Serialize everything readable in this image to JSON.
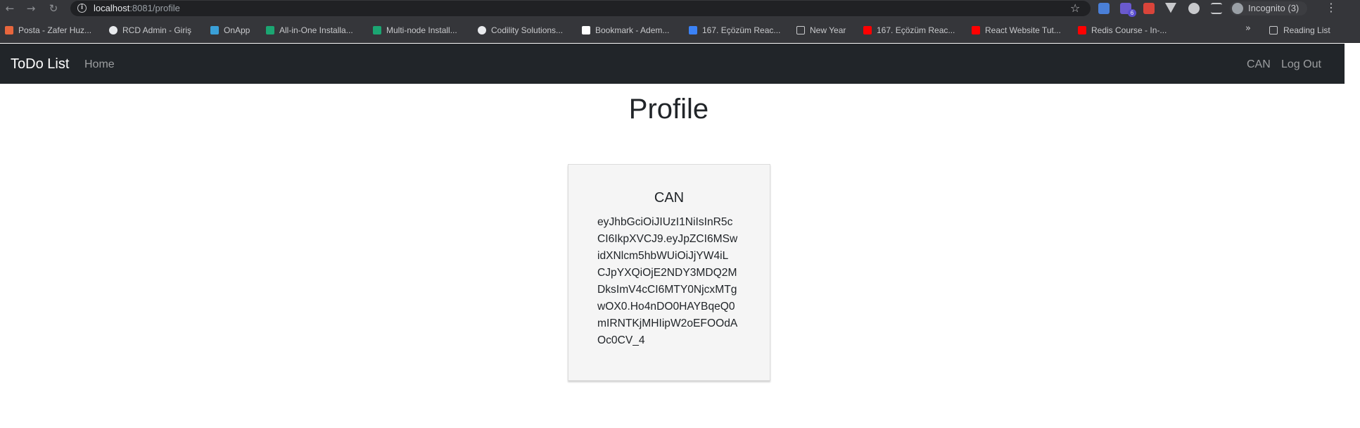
{
  "browser": {
    "url_host": "localhost",
    "url_path": ":8081/profile",
    "extension_badge": "6",
    "incognito_label": "Incognito (3)",
    "bookmarks": [
      {
        "label": "Posta - Zafer Huz...",
        "icon": "mail-icon",
        "color": "#e8663d"
      },
      {
        "label": "RCD Admin - Giriş",
        "icon": "globe-icon",
        "color": "#e8eaed"
      },
      {
        "label": "OnApp",
        "icon": "onapp-icon",
        "color": "#3aa0d8"
      },
      {
        "label": "All-in-One Installa...",
        "icon": "cube-icon",
        "color": "#1ba672"
      },
      {
        "label": "Multi-node Install...",
        "icon": "cube-icon",
        "color": "#1ba672"
      },
      {
        "label": "Codility Solutions...",
        "icon": "github-icon",
        "color": "#e8eaed"
      },
      {
        "label": "Bookmark - Adem...",
        "icon": "page-icon",
        "color": "#ffffff"
      },
      {
        "label": "167. Eçözüm Reac...",
        "icon": "list-icon",
        "color": "#3b82f6"
      },
      {
        "label": "New Year",
        "icon": "folder-icon",
        "color": "#c8c9cc"
      },
      {
        "label": "167. Eçözüm Reac...",
        "icon": "youtube-icon",
        "color": "#ff0000"
      },
      {
        "label": "React Website Tut...",
        "icon": "youtube-icon",
        "color": "#ff0000"
      },
      {
        "label": "Redis Course - In-...",
        "icon": "youtube-icon",
        "color": "#ff0000"
      }
    ],
    "reading_list": "Reading List"
  },
  "navbar": {
    "brand": "ToDo List",
    "home": "Home",
    "user": "CAN",
    "logout": "Log Out"
  },
  "page": {
    "title": "Profile",
    "card": {
      "name": "CAN",
      "token_lines": [
        "eyJhbGciOiJIUzI1NiIsInR5c",
        "CI6IkpXVCJ9.eyJpZCI6MSw",
        "idXNlcm5hbWUiOiJjYW4iL",
        "CJpYXQiOjE2NDY3MDQ2M",
        "DksImV4cCI6MTY0NjcxMTg",
        "wOX0.Ho4nDO0HAYBqeQ0",
        "mIRNTKjMHIipW2oEFOOdA",
        "Oc0CV_4"
      ]
    }
  }
}
